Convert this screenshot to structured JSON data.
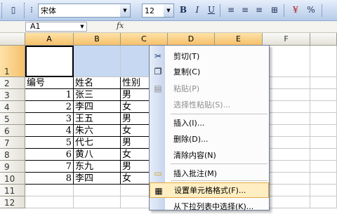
{
  "toolbar": {
    "font_name": "宋体",
    "font_size": "12",
    "bold_label": "B",
    "italic_label": "I",
    "underline_label": "U",
    "percent_label": "%"
  },
  "formula_bar": {
    "name_box": "A1",
    "fx_label": "fx"
  },
  "columns": [
    "A",
    "B",
    "C",
    "D",
    "E",
    "F"
  ],
  "rows": [
    "1",
    "2",
    "3",
    "4",
    "5",
    "6",
    "7",
    "8",
    "9",
    "10",
    "11",
    "12"
  ],
  "table": {
    "headers": [
      "编号",
      "姓名",
      "性别"
    ],
    "records": [
      [
        "1",
        "张三",
        "男"
      ],
      [
        "2",
        "李四",
        "女"
      ],
      [
        "3",
        "王五",
        "男"
      ],
      [
        "4",
        "朱六",
        "女"
      ],
      [
        "5",
        "代七",
        "男"
      ],
      [
        "6",
        "黄八",
        "女"
      ],
      [
        "7",
        "东九",
        "男"
      ],
      [
        "8",
        "李四",
        "女"
      ]
    ]
  },
  "context_menu": {
    "items": [
      {
        "label": "剪切(T)",
        "icon": "scissors-icon",
        "disabled": false
      },
      {
        "label": "复制(C)",
        "icon": "copy-icon",
        "disabled": false
      },
      {
        "label": "粘贴(P)",
        "icon": "paste-icon",
        "disabled": true
      },
      {
        "label": "选择性粘贴(S)...",
        "icon": "",
        "disabled": true
      },
      {
        "label": "插入(I)...",
        "icon": "",
        "disabled": false
      },
      {
        "label": "删除(D)...",
        "icon": "",
        "disabled": false
      },
      {
        "label": "清除内容(N)",
        "icon": "",
        "disabled": false
      },
      {
        "label": "插入批注(M)",
        "icon": "comment-icon",
        "disabled": false
      },
      {
        "label": "设置单元格格式(F)...",
        "icon": "format-cells-icon",
        "disabled": false,
        "highlighted": true
      },
      {
        "label": "从下拉列表中选择(K)...",
        "icon": "",
        "disabled": false
      }
    ]
  }
}
